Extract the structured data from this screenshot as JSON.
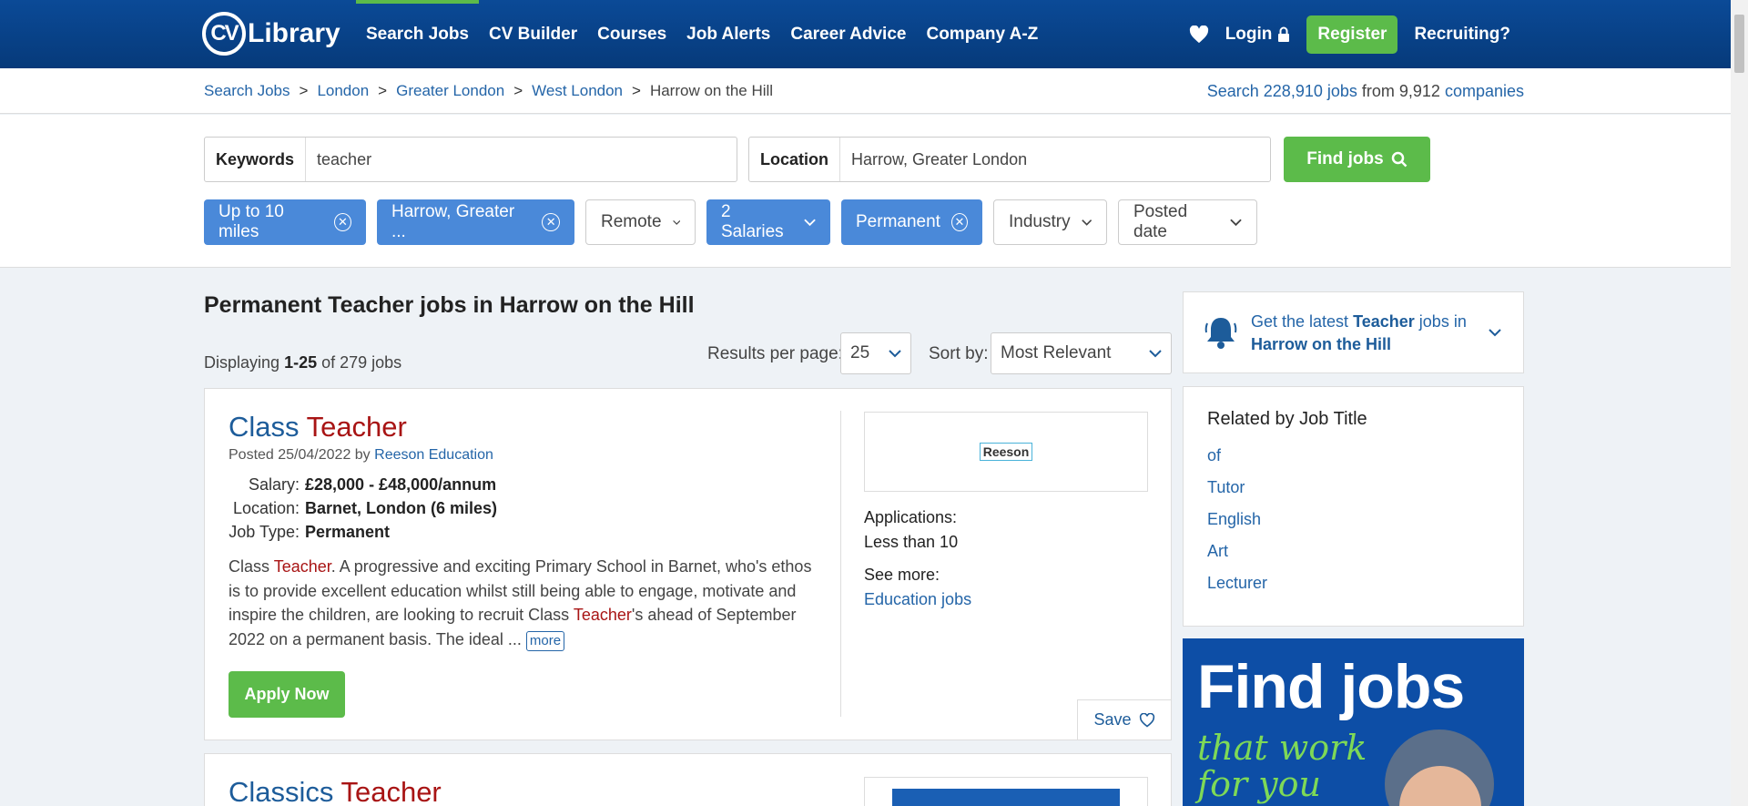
{
  "header": {
    "logo_cv": "CV",
    "logo_text": "Library",
    "nav": [
      "Search Jobs",
      "CV Builder",
      "Courses",
      "Job Alerts",
      "Career Advice",
      "Company A-Z"
    ],
    "login": "Login",
    "register": "Register",
    "recruiting": "Recruiting?"
  },
  "breadcrumb": [
    "Search Jobs",
    "London",
    "Greater London",
    "West London",
    "Harrow on the Hill"
  ],
  "job_count": {
    "prefix": "Search",
    "jobs": "228,910 jobs",
    "from": "from 9,912",
    "companies": "companies"
  },
  "search": {
    "keywords_label": "Keywords",
    "keywords_value": "teacher",
    "location_label": "Location",
    "location_value": "Harrow, Greater London",
    "find_button": "Find jobs"
  },
  "filters": [
    {
      "label": "Up to 10 miles",
      "active": true,
      "control": "remove"
    },
    {
      "label": "Harrow, Greater ...",
      "active": true,
      "control": "remove"
    },
    {
      "label": "Remote",
      "active": false,
      "control": "dropdown"
    },
    {
      "label": "2 Salaries",
      "active": true,
      "control": "dropdown"
    },
    {
      "label": "Permanent",
      "active": true,
      "control": "remove"
    },
    {
      "label": "Industry",
      "active": false,
      "control": "dropdown"
    },
    {
      "label": "Posted date",
      "active": false,
      "control": "dropdown"
    }
  ],
  "results": {
    "title": "Permanent Teacher jobs in Harrow on the Hill",
    "displaying": "Displaying",
    "range": "1-25",
    "of_total": "of 279 jobs",
    "per_page_label": "Results per page:",
    "per_page_value": "25",
    "sort_label": "Sort by:",
    "sort_value": "Most Relevant"
  },
  "jobs": [
    {
      "title_a": "Class",
      "title_b": "Teacher",
      "posted": "Posted 25/04/2022 by",
      "company": "Reeson Education",
      "salary_label": "Salary:",
      "salary": "£28,000 - £48,000/annum",
      "location_label": "Location:",
      "location": "Barnet, London (6 miles)",
      "type_label": "Job Type:",
      "type": "Permanent",
      "desc_1": "Class ",
      "desc_hl1": "Teacher",
      "desc_2": ". A progressive and exciting Primary School in Barnet, who's ethos is to provide excellent education whilst still being able to engage, motivate and inspire the children, are looking to recruit Class ",
      "desc_hl2": "Teacher",
      "desc_3": "'s ahead of September 2022 on a permanent basis. The ideal ... ",
      "more": "more",
      "apply": "Apply Now",
      "logo_text": "Reeson",
      "applications_label": "Applications:",
      "applications": "Less than 10",
      "see_more_label": "See more:",
      "see_more_link": "Education jobs",
      "save": "Save"
    },
    {
      "title_a": "Classics",
      "title_b": "Teacher"
    }
  ],
  "sidebar": {
    "alert_1": "Get the latest",
    "alert_kw": "Teacher",
    "alert_2": "jobs in",
    "alert_place": "Harrow on the Hill",
    "related_title": "Related by Job Title",
    "related": [
      "of",
      "Tutor",
      "English",
      "Art",
      "Lecturer"
    ],
    "promo_big": "Find jobs",
    "promo_small_1": "that work",
    "promo_small_2": "for you"
  },
  "colors": {
    "brand_blue": "#0b4a97",
    "accent_green": "#5cbb4a",
    "chip_blue": "#4a89d9",
    "highlight_red": "#a81414"
  }
}
